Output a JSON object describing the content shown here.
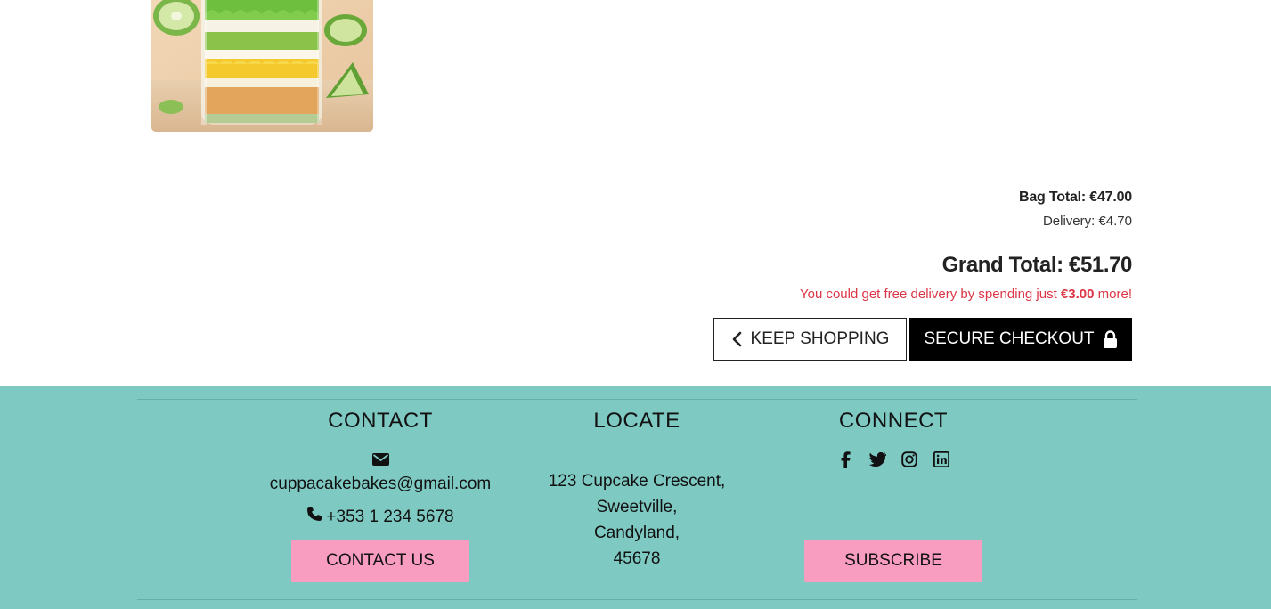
{
  "bag": {
    "bag_total": "Bag Total: €47.00",
    "delivery": "Delivery: €4.70",
    "grand_total": "Grand Total: €51.70",
    "free_delivery_prefix": "You could get free delivery by spending just ",
    "free_delivery_amount": "€3.00",
    "free_delivery_suffix": " more!",
    "keep_shopping_label": "KEEP SHOPPING",
    "checkout_label": "SECURE CHECKOUT"
  },
  "footer": {
    "contact": {
      "title": "CONTACT",
      "email": "cuppacakebakes@gmail.com",
      "phone": "+353 1 234 5678",
      "button": "CONTACT US"
    },
    "locate": {
      "title": "LOCATE",
      "address": [
        "123 Cupcake Crescent,",
        "Sweetville,",
        "Candyland,",
        "45678"
      ]
    },
    "connect": {
      "title": "CONNECT",
      "icons": [
        "facebook-icon",
        "twitter-icon",
        "instagram-icon",
        "linkedin-icon"
      ],
      "button": "SUBSCRIBE"
    }
  },
  "colors": {
    "footer_bg": "#7ecac3",
    "pink_button": "#f99dc0",
    "warning_red": "#dc3545",
    "checkout_bg": "#000000"
  }
}
